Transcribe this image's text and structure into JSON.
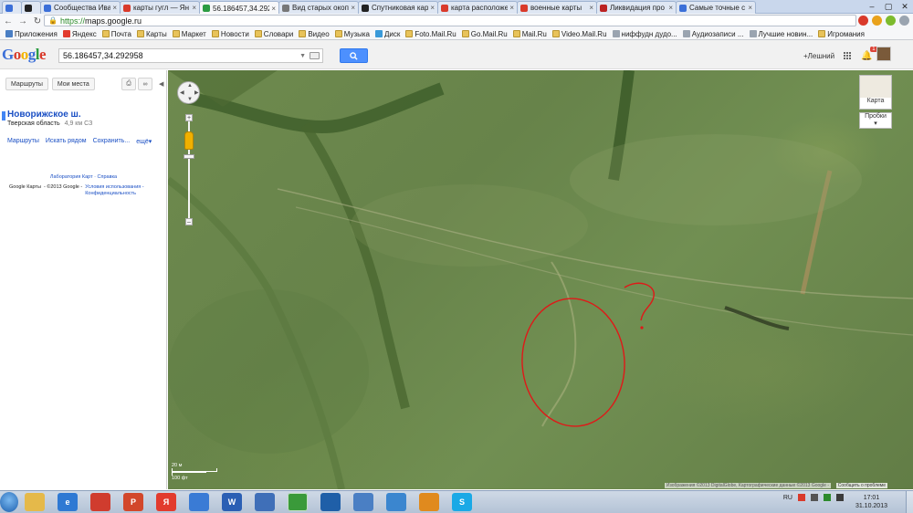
{
  "browser": {
    "tabs": [
      {
        "title": "",
        "color": "#3b6fd8"
      },
      {
        "title": "",
        "color": "#222"
      },
      {
        "title": "Сообщества Ива",
        "color": "#3b6fd8"
      },
      {
        "title": "карты гугл — Ян",
        "color": "#d93a2b"
      },
      {
        "title": "56.186457,34.292",
        "color": "#2c9c42",
        "active": true
      },
      {
        "title": "Вид старых окоп",
        "color": "#777"
      },
      {
        "title": "Спутниковая кар",
        "color": "#222"
      },
      {
        "title": "карта расположе",
        "color": "#d93a2b"
      },
      {
        "title": "военные карты",
        "color": "#d93a2b"
      },
      {
        "title": "Ликвидация про",
        "color": "#b22"
      },
      {
        "title": "Самые точные с",
        "color": "#3b6fd8"
      }
    ],
    "url_scheme": "https://",
    "url_host": "maps.google.ru",
    "bookmarks": [
      {
        "label": "Приложения",
        "icon": "apps"
      },
      {
        "label": "Яндекс",
        "icon": "yandex"
      },
      {
        "label": "Почта",
        "icon": "folder"
      },
      {
        "label": "Карты",
        "icon": "folder"
      },
      {
        "label": "Маркет",
        "icon": "folder"
      },
      {
        "label": "Новости",
        "icon": "folder"
      },
      {
        "label": "Словари",
        "icon": "folder"
      },
      {
        "label": "Видео",
        "icon": "folder"
      },
      {
        "label": "Музыка",
        "icon": "folder"
      },
      {
        "label": "Диск",
        "icon": "disk"
      },
      {
        "label": "Foto.Mail.Ru",
        "icon": "folder"
      },
      {
        "label": "Go.Mail.Ru",
        "icon": "folder"
      },
      {
        "label": "Mail.Ru",
        "icon": "folder"
      },
      {
        "label": "Video.Mail.Ru",
        "icon": "folder"
      },
      {
        "label": "ниффудн дудо...",
        "icon": "page"
      },
      {
        "label": "Аудиозаписи ...",
        "icon": "page"
      },
      {
        "label": "Лучшие новин...",
        "icon": "page"
      },
      {
        "label": "Игромания",
        "icon": "folder"
      }
    ]
  },
  "gmaps": {
    "search_value": "56.186457,34.292958",
    "user_name": "+Лешний",
    "notification_count": "1",
    "left": {
      "btn_routes": "Маршруты",
      "btn_myplaces": "Мои места",
      "place_title": "Новорижское ш.",
      "place_region": "Тверская область",
      "place_distance": "4,9 км СЗ",
      "link_routes": "Маршруты",
      "link_nearby": "Искать рядом",
      "link_save": "Сохранить...",
      "link_more": "ещё",
      "footer_links": "Лаборатория Карт · Справка",
      "footer_brand": "Google Карты",
      "footer_copy": "- ©2013 Google -",
      "footer_terms": "Условия использования -",
      "footer_privacy": "Конфиденциальность"
    },
    "map": {
      "maptype_label": "Карта",
      "traffic_label": "Пробки",
      "scale_metric": "20 м",
      "scale_imperial": "100 фт",
      "attribution": "Изображения ©2013 DigitalGlobe, Картографические данные ©2013 Google -",
      "report": "Сообщить о проблеме"
    }
  },
  "taskbar": {
    "apps": [
      {
        "name": "explorer",
        "color": "#e5b94a"
      },
      {
        "name": "ie",
        "color": "#2f79d3",
        "glyph": "e"
      },
      {
        "name": "media",
        "color": "#d03c2e"
      },
      {
        "name": "powerpoint",
        "color": "#d2472b",
        "glyph": "P"
      },
      {
        "name": "yandex",
        "color": "#e23b2e",
        "glyph": "Я"
      },
      {
        "name": "mail",
        "color": "#3a7bd5"
      },
      {
        "name": "word",
        "color": "#2b5fb4",
        "glyph": "W"
      },
      {
        "name": "app",
        "color": "#3f6fb8"
      },
      {
        "name": "chrome",
        "color": "#3a9a3a",
        "open": true
      },
      {
        "name": "player",
        "color": "#1f5fa8"
      },
      {
        "name": "paint",
        "color": "#4a7fc4"
      },
      {
        "name": "sound",
        "color": "#3b86cf"
      },
      {
        "name": "game",
        "color": "#e08a1e"
      },
      {
        "name": "skype",
        "color": "#1aa9e6",
        "glyph": "S"
      }
    ],
    "lang": "RU",
    "time": "17:01",
    "date": "31.10.2013"
  }
}
